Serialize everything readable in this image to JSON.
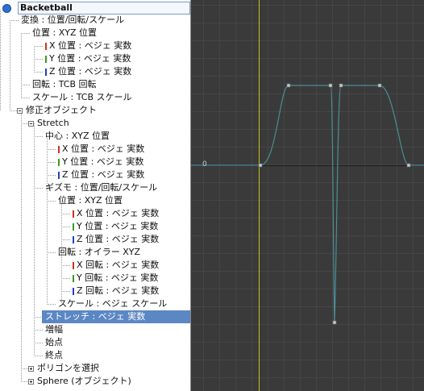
{
  "tree": {
    "root_label": "Backetball",
    "items": [
      {
        "label": "変換 : 位置/回転/スケール",
        "axis": null,
        "selected": false
      },
      {
        "label": "位置 : XYZ 位置",
        "axis": null,
        "selected": false
      },
      {
        "label": "X 位置 : ベジェ 実数",
        "axis": "x",
        "selected": false
      },
      {
        "label": "Y 位置 : ベジェ 実数",
        "axis": "y",
        "selected": false
      },
      {
        "label": "Z 位置 : ベジェ 実数",
        "axis": "z",
        "selected": false
      },
      {
        "label": "回転 : TCB 回転",
        "axis": null,
        "selected": false
      },
      {
        "label": "スケール : TCB スケール",
        "axis": null,
        "selected": false
      },
      {
        "label": "修正オブジェクト",
        "axis": null,
        "selected": false
      },
      {
        "label": "Stretch",
        "axis": null,
        "selected": false
      },
      {
        "label": "中心 : XYZ 位置",
        "axis": null,
        "selected": false
      },
      {
        "label": "X 位置 : ベジェ 実数",
        "axis": "x",
        "selected": false
      },
      {
        "label": "Y 位置 : ベジェ 実数",
        "axis": "y",
        "selected": false
      },
      {
        "label": "Z 位置 : ベジェ 実数",
        "axis": "z",
        "selected": false
      },
      {
        "label": "ギズモ : 位置/回転/スケール",
        "axis": null,
        "selected": false
      },
      {
        "label": "位置 : XYZ 位置",
        "axis": null,
        "selected": false
      },
      {
        "label": "X 位置 : ベジェ 実数",
        "axis": "x",
        "selected": false
      },
      {
        "label": "Y 位置 : ベジェ 実数",
        "axis": "y",
        "selected": false
      },
      {
        "label": "Z 位置 : ベジェ 実数",
        "axis": "z",
        "selected": false
      },
      {
        "label": "回転 : オイラー XYZ",
        "axis": null,
        "selected": false
      },
      {
        "label": "X 回転 : ベジェ 実数",
        "axis": "x",
        "selected": false
      },
      {
        "label": "Y 回転 : ベジェ 実数",
        "axis": "y",
        "selected": false
      },
      {
        "label": "Z 回転 : ベジェ 実数",
        "axis": "z",
        "selected": false
      },
      {
        "label": "スケール : ベジェ スケール",
        "axis": null,
        "selected": false
      },
      {
        "label": "ストレッチ : ベジェ 実数",
        "axis": null,
        "selected": true
      },
      {
        "label": "増幅",
        "axis": null,
        "selected": false
      },
      {
        "label": "始点",
        "axis": null,
        "selected": false
      },
      {
        "label": "終点",
        "axis": null,
        "selected": false
      },
      {
        "label": "ポリゴンを選択",
        "axis": null,
        "selected": false
      },
      {
        "label": "Sphere (オブジェクト)",
        "axis": null,
        "selected": false
      }
    ]
  },
  "colors": {
    "axis_x": "#d0301c",
    "axis_y": "#3a9a20",
    "axis_z": "#2040c8",
    "selection": "#5b87c4",
    "curve": "#4a8e94",
    "graph_bg": "#3a3a3a",
    "time_marker": "#c8c020"
  },
  "graph": {
    "zero_label": "0"
  }
}
